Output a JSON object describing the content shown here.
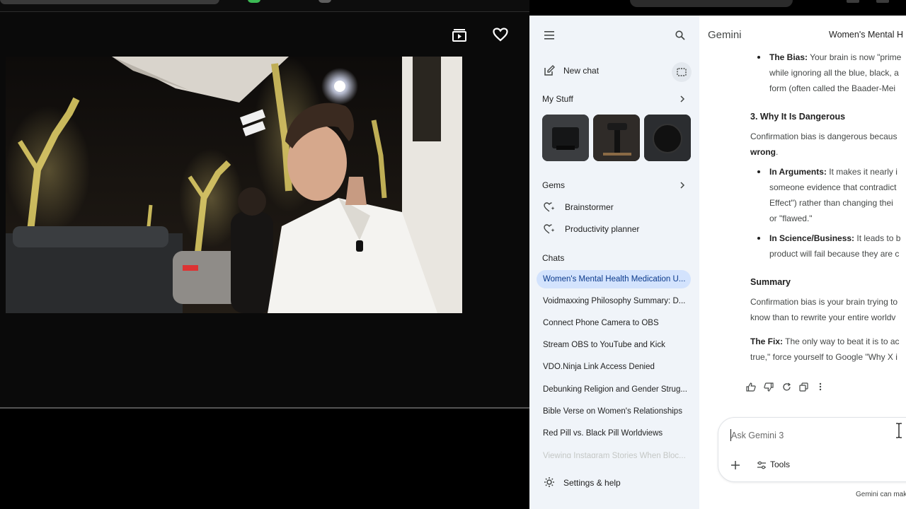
{
  "left": {
    "icons": {
      "playlist": "playlist-icon",
      "favorite": "heart-icon"
    }
  },
  "sidebar": {
    "new_chat": "New chat",
    "my_stuff": "My Stuff",
    "gems_title": "Gems",
    "gems": [
      "Brainstormer",
      "Productivity planner"
    ],
    "chats_title": "Chats",
    "chats": [
      "Women's Mental Health Medication U...",
      "Voidmaxxing Philosophy Summary: D...",
      "Connect Phone Camera to OBS",
      "Stream OBS to YouTube and Kick",
      "VDO.Ninja Link Access Denied",
      "Debunking Religion and Gender Strug...",
      "Bible Verse on Women's Relationships",
      "Red Pill vs. Black Pill Worldviews",
      "Viewing Instagram Stories When Bloc..."
    ],
    "settings": "Settings & help"
  },
  "main": {
    "app_title": "Gemini",
    "conversation_title": "Women's Mental H",
    "bias_label": "The Bias:",
    "bias_line1": "Your brain is now \"prime",
    "bias_line2": "while ignoring all the blue, black, a",
    "bias_line3": "form (often called the Baader-Mei",
    "section3": "3. Why It Is Dangerous",
    "danger_line1": "Confirmation bias is dangerous becaus",
    "danger_line2": "wrong",
    "arguments_label": "In Arguments:",
    "arguments_line1": "It makes it nearly i",
    "arguments_line2": "someone evidence that contradict",
    "arguments_line3": "Effect\") rather than changing thei",
    "arguments_line4": "or \"flawed.\"",
    "science_label": "In Science/Business:",
    "science_line1": "It leads to b",
    "science_line2": "product will fail because they are c",
    "summary_title": "Summary",
    "summary_line1": "Confirmation bias is your brain trying to",
    "summary_line2": "know than to rewrite your entire worldv",
    "fix_label": "The Fix:",
    "fix_line1": "The only way to beat it is to ac",
    "fix_line2": "true,\" force yourself to Google \"Why X i",
    "input_placeholder": "Ask Gemini 3",
    "tools_label": "Tools",
    "disclaimer": "Gemini can mak"
  }
}
